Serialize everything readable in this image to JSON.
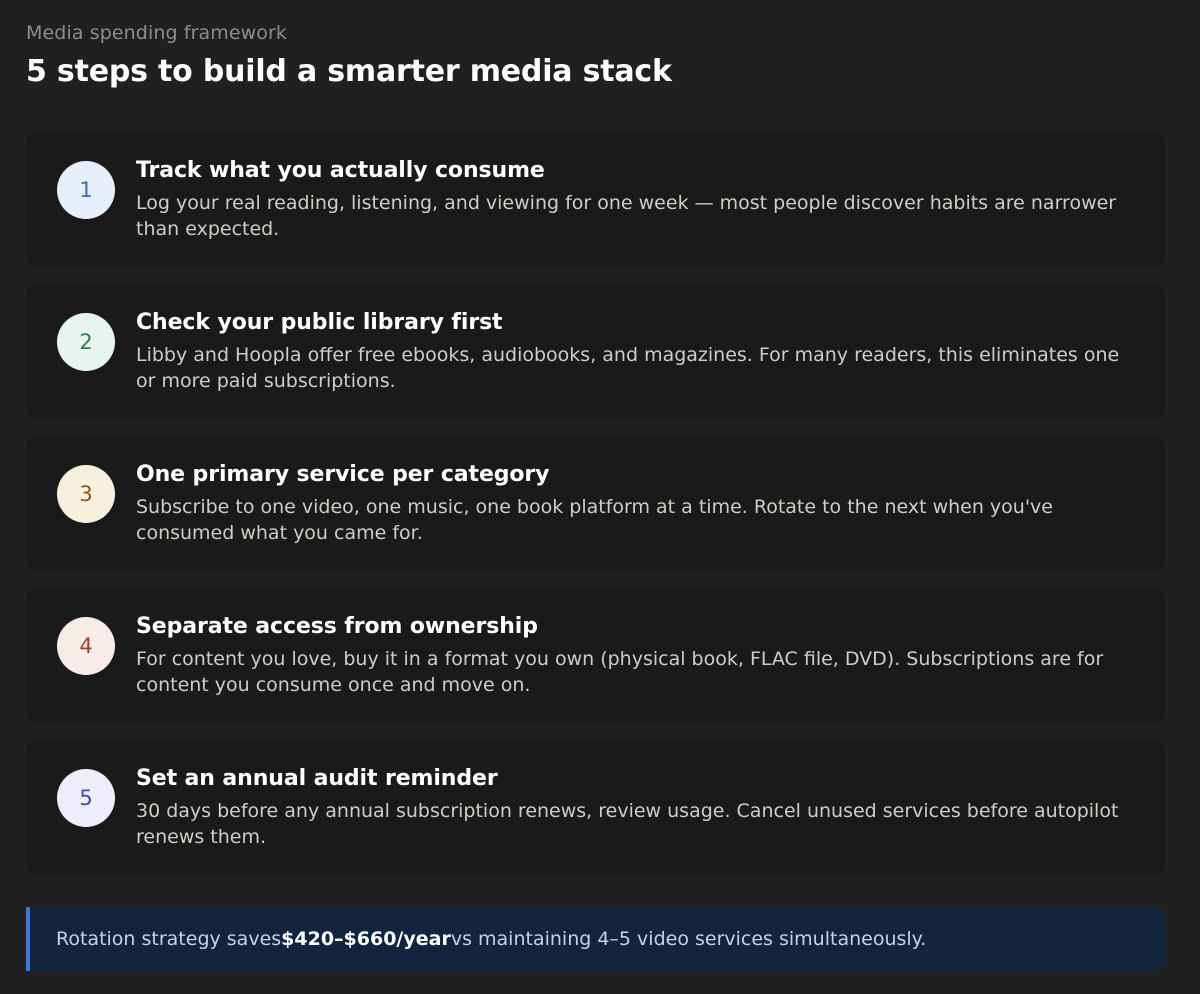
{
  "header": {
    "eyebrow": "Media spending framework",
    "title": "5 steps to build a smarter media stack"
  },
  "steps": [
    {
      "number": "1",
      "title": "Track what you actually consume",
      "description": "Log your real reading, listening, and viewing for one week — most people discover habits are narrower than expected.",
      "circle_bg": "#e6effa",
      "circle_fg": "#3f6fae"
    },
    {
      "number": "2",
      "title": "Check your public library first",
      "description": "Libby and Hoopla offer free ebooks, audiobooks, and magazines. For many readers, this eliminates one or more paid subscriptions.",
      "circle_bg": "#e7f5ee",
      "circle_fg": "#2f7a59"
    },
    {
      "number": "3",
      "title": "One primary service per category",
      "description": "Subscribe to one video, one music, one book platform at a time. Rotate to the next when you've consumed what you came for.",
      "circle_bg": "#f8f0df",
      "circle_fg": "#8a5a18"
    },
    {
      "number": "4",
      "title": "Separate access from ownership",
      "description": "For content you love, buy it in a format you own (physical book, FLAC file, DVD). Subscriptions are for content you consume once and move on.",
      "circle_bg": "#f8ece8",
      "circle_fg": "#9a3f2d"
    },
    {
      "number": "5",
      "title": "Set an annual audit reminder",
      "description": "30 days before any annual subscription renews, review usage. Cancel unused services before autopilot renews them.",
      "circle_bg": "#ededfb",
      "circle_fg": "#4a46a8"
    }
  ],
  "callout": {
    "prefix": "Rotation strategy saves ",
    "highlight": "$420–$660/year",
    "suffix": " vs maintaining 4–5 video services simultaneously."
  },
  "colors": {
    "background": "#202020",
    "card": "#1a1a1a",
    "callout_bg": "#13243f",
    "callout_border": "#3b78d8"
  }
}
